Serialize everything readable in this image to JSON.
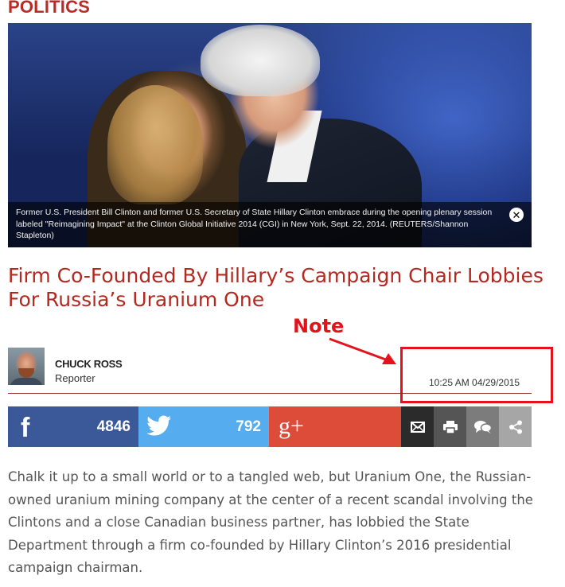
{
  "section": {
    "label": "POLITICS"
  },
  "hero": {
    "caption": "Former U.S. President Bill Clinton and former U.S. Secretary of State Hillary Clinton embrace during the opening plenary session labeled \"Reimagining Impact\" at the Clinton Global Initiative 2014 (CGI) in New York, Sept. 22, 2014. (REUTERS/Shannon Stapleton)",
    "close_icon": "close-icon"
  },
  "article": {
    "headline": "Firm Co-Founded By Hillary’s Campaign Chair Lobbies For Russia’s Uranium One",
    "author": {
      "name": "CHUCK ROSS",
      "role": "Reporter"
    },
    "timestamp": "10:25 AM 04/29/2015",
    "body": "Chalk it up to a small world or to a tangled web, but Uranium One, the Russian-owned uranium mining company at the center of a recent scandal involving the Clintons and a close Canadian business partner, has lobbied the State Department through a firm co-founded by Hillary Clinton’s 2016 presidential campaign chairman."
  },
  "annotation": {
    "label": "Note",
    "color": "#e3121b"
  },
  "share": {
    "facebook": {
      "glyph": "f",
      "count": "4846",
      "color": "#3b5998",
      "icon": "facebook-icon"
    },
    "twitter": {
      "count": "792",
      "color": "#55acee",
      "icon": "twitter-bird-icon"
    },
    "googleplus": {
      "glyph": "g+",
      "color": "#dd4b39",
      "icon": "google-plus-icon"
    },
    "utilities": [
      {
        "icon": "email-icon",
        "color": "#2b2b2b"
      },
      {
        "icon": "print-icon",
        "color": "#555555"
      },
      {
        "icon": "comment-icon",
        "color": "#7c7c7c"
      },
      {
        "icon": "share-icon",
        "color": "#a6a6a6"
      }
    ]
  },
  "colors": {
    "brand_red": "#b3281f",
    "section_red": "#b92b27"
  }
}
